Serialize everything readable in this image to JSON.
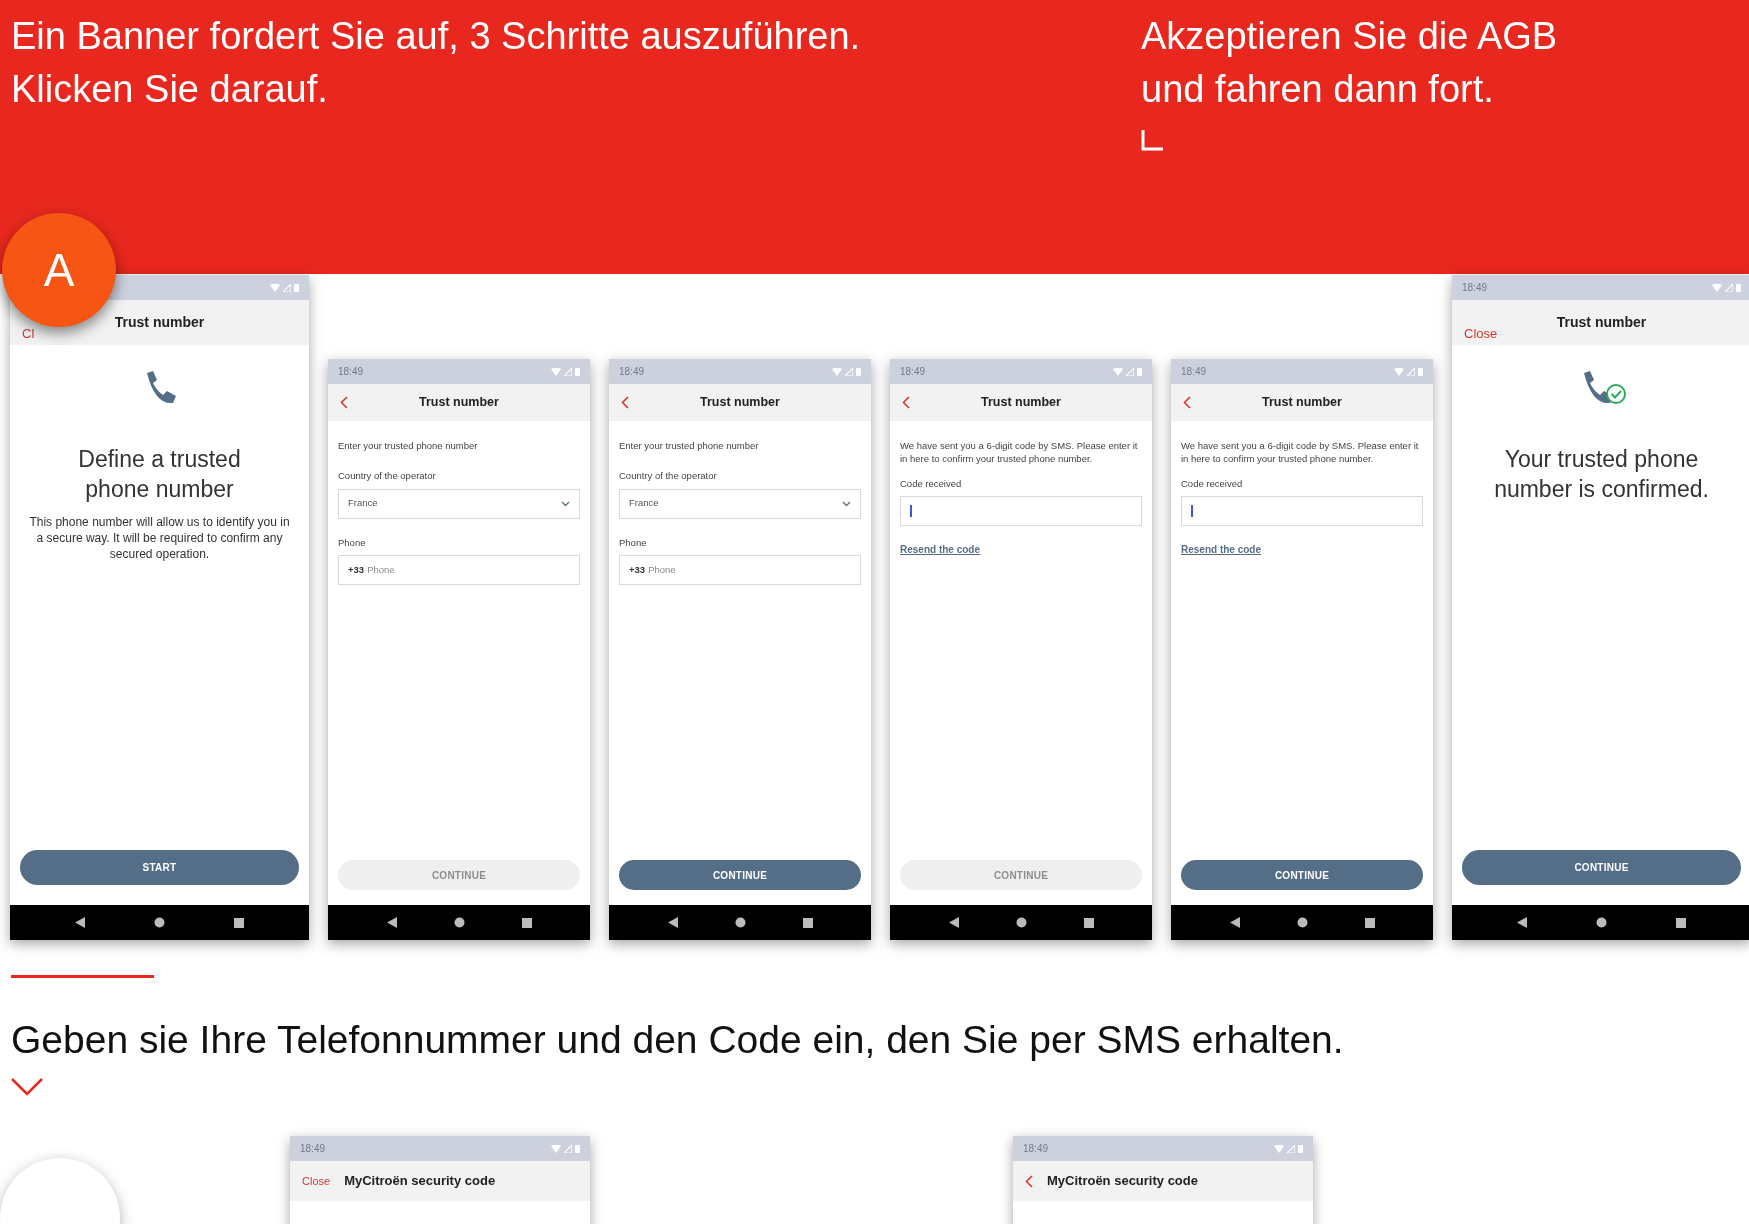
{
  "banner": {
    "columns": [
      {
        "lines": [
          "Ein Banner fordert Sie auf, 3 Schritte auszuführen.",
          "Klicken Sie darauf."
        ],
        "corner_mark": false
      },
      {
        "lines": [
          "Akzeptieren Sie die AGB",
          "und fahren dann fort."
        ],
        "corner_mark": true
      }
    ]
  },
  "step_badge": "A",
  "phones": [
    {
      "kind": "intro",
      "header": {
        "close": "Cl",
        "title": "Trust number"
      },
      "heading": "Define a trusted phone number",
      "text": "This phone number will allow us to identify you in a secure way. It will be required to confirm any secured operation.",
      "button": {
        "label": "START",
        "disabled": false
      }
    },
    {
      "kind": "phone_form",
      "time": "18:49",
      "header": {
        "back": true,
        "title": "Trust number"
      },
      "intro": "Enter your trusted phone number",
      "country_label": "Country of the operator",
      "country": "France",
      "phone_label": "Phone",
      "prefix": "+33",
      "placeholder": "Phone",
      "button": {
        "label": "CONTINUE",
        "disabled": true
      }
    },
    {
      "kind": "phone_form",
      "time": "18:49",
      "header": {
        "back": true,
        "title": "Trust number"
      },
      "intro": "Enter your trusted phone number",
      "country_label": "Country of the operator",
      "country": "France",
      "phone_label": "Phone",
      "prefix": "+33",
      "placeholder": "Phone",
      "button": {
        "label": "CONTINUE",
        "disabled": false
      }
    },
    {
      "kind": "code_form",
      "time": "18:49",
      "header": {
        "back": true,
        "title": "Trust number"
      },
      "intro": "We have sent you a 6-digit code by SMS. Please enter it in here to confirm your trusted phone number.",
      "code_label": "Code received",
      "focused": true,
      "link": "Resend the code",
      "button": {
        "label": "CONTINUE",
        "disabled": true
      }
    },
    {
      "kind": "code_form",
      "time": "18:49",
      "header": {
        "back": true,
        "title": "Trust number"
      },
      "intro": "We have sent you a 6-digit code by SMS. Please enter it in here to confirm your trusted phone number.",
      "code_label": "Code received",
      "focused": true,
      "link": "Resend the code",
      "button": {
        "label": "CONTINUE",
        "disabled": false
      }
    },
    {
      "kind": "confirmed",
      "time": "18:49",
      "header": {
        "close": "Close",
        "title": "Trust number"
      },
      "heading": "Your trusted phone number is confirmed.",
      "button": {
        "label": "CONTINUE",
        "disabled": false
      }
    }
  ],
  "section": {
    "heading": "Geben sie Ihre Telefonnummer und den Code ein, den Sie per SMS erhalten."
  },
  "bottom_phones": [
    {
      "time": "18:49",
      "header": {
        "close": "Close",
        "title": "MyCitroën security code"
      }
    },
    {
      "time": "18:49",
      "header": {
        "back": true,
        "title": "MyCitroën security code"
      }
    }
  ]
}
